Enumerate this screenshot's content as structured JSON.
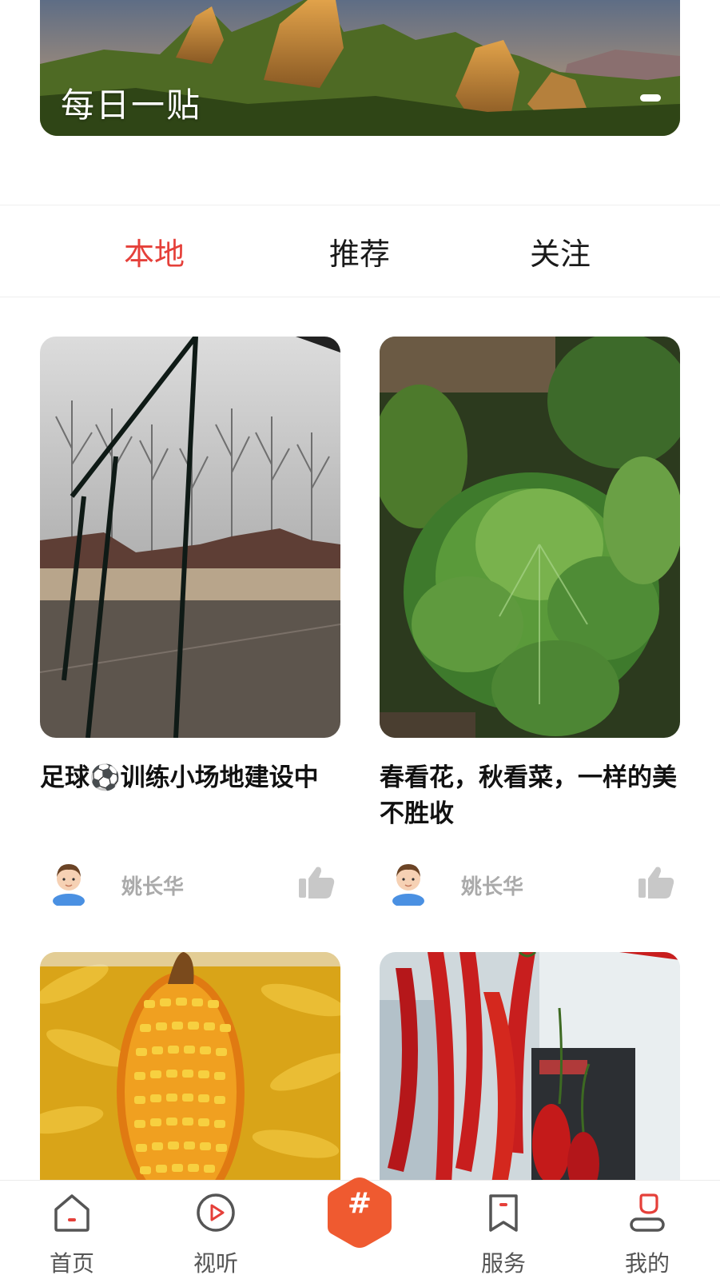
{
  "banner": {
    "title": "每日一贴"
  },
  "tabs": [
    {
      "label": "本地",
      "active": true
    },
    {
      "label": "推荐",
      "active": false
    },
    {
      "label": "关注",
      "active": false
    }
  ],
  "feed": [
    {
      "title": "足球⚽训练小场地建设中",
      "author": "姚长华",
      "image": "soccer-field-photo"
    },
    {
      "title": "春看花，秋看菜，一样的美不胜收",
      "author": "姚长华",
      "image": "cabbage-photo"
    },
    {
      "title": "",
      "author": "",
      "image": "corn-photo"
    },
    {
      "title": "",
      "author": "",
      "image": "red-peppers-photo"
    }
  ],
  "bottom_nav": {
    "home": "首页",
    "video": "视听",
    "center": "#",
    "services": "服务",
    "mine": "我的"
  },
  "colors": {
    "accent": "#e5403a",
    "center_button": "#ef5a30",
    "nav_icon": "#555555",
    "author_text": "#aaaaaa",
    "avatar_shirt": "#4a90e2"
  },
  "icons": {
    "home": "home-icon",
    "video": "play-circle-icon",
    "services": "bookmark-icon",
    "mine": "user-icon",
    "like": "thumbs-up-icon"
  }
}
